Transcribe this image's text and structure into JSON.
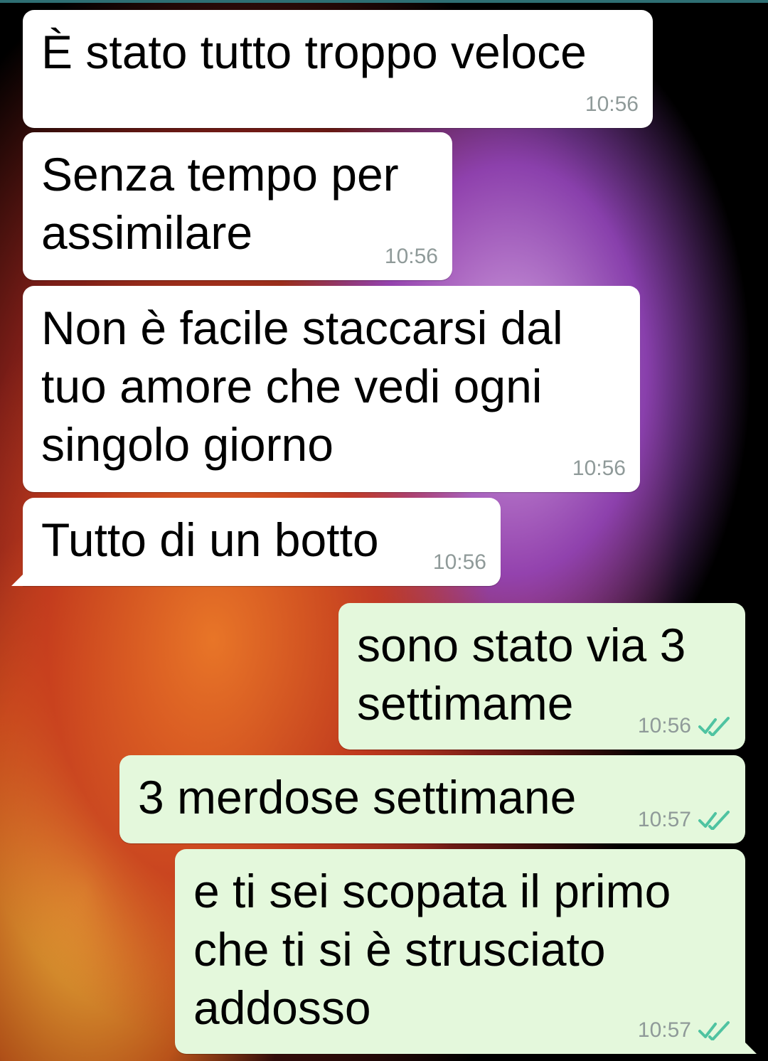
{
  "messages": [
    {
      "direction": "incoming",
      "text": "È stato tutto troppo veloce",
      "time": "10:56"
    },
    {
      "direction": "incoming",
      "text": "Senza tempo per\nassimilare",
      "time": "10:56"
    },
    {
      "direction": "incoming",
      "text": "Non è facile staccarsi dal\ntuo amore che vedi ogni\nsingolo giorno",
      "time": "10:56"
    },
    {
      "direction": "incoming",
      "text": "Tutto di un botto",
      "time": "10:56"
    },
    {
      "direction": "outgoing",
      "text": "sono stato via 3\nsettimame",
      "time": "10:56",
      "status_icon": "double-check-icon"
    },
    {
      "direction": "outgoing",
      "text": "3 merdose settimane",
      "time": "10:57",
      "status_icon": "double-check-icon"
    },
    {
      "direction": "outgoing",
      "text": "e ti sei scopata il primo\nche ti si è strusciato\naddosso",
      "time": "10:57",
      "status_icon": "double-check-icon"
    }
  ],
  "colors": {
    "incoming_bubble": "#ffffff",
    "outgoing_bubble": "#e4f8dc",
    "timestamp": "#8f9a99",
    "read_ticks": "#4fc3a1"
  }
}
